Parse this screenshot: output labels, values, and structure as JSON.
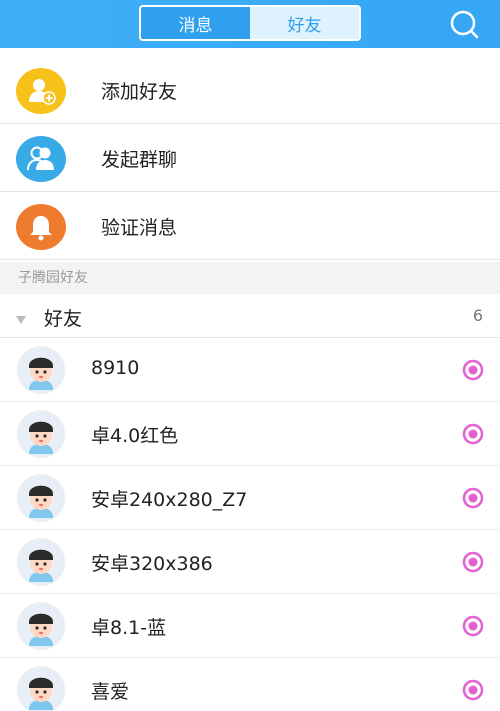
{
  "header": {
    "tabs": [
      {
        "label": "消息",
        "active": true
      },
      {
        "label": "好友",
        "active": false
      }
    ],
    "search_icon": "search-icon"
  },
  "menu": [
    {
      "label": "添加好友",
      "icon": "add-friend-icon",
      "color": "#f6c21a"
    },
    {
      "label": "发起群聊",
      "icon": "group-chat-icon",
      "color": "#38aae6"
    },
    {
      "label": "验证消息",
      "icon": "bell-icon",
      "color": "#ef7b2e"
    }
  ],
  "section": {
    "title": "子腾园好友"
  },
  "group": {
    "label": "好友",
    "count": "6"
  },
  "friends": [
    {
      "name": "8910",
      "status_icon": "device-online-icon"
    },
    {
      "name": "卓4.0红色",
      "status_icon": "device-online-icon"
    },
    {
      "name": "安卓240x280_Z7",
      "status_icon": "device-online-icon"
    },
    {
      "name": "安卓320x386",
      "status_icon": "device-online-icon"
    },
    {
      "name": "卓8.1-蓝",
      "status_icon": "device-online-icon"
    },
    {
      "name": "喜爱",
      "status_icon": "device-online-icon"
    }
  ],
  "colors": {
    "header": "#36a6f5",
    "status": "#e45fd0"
  }
}
